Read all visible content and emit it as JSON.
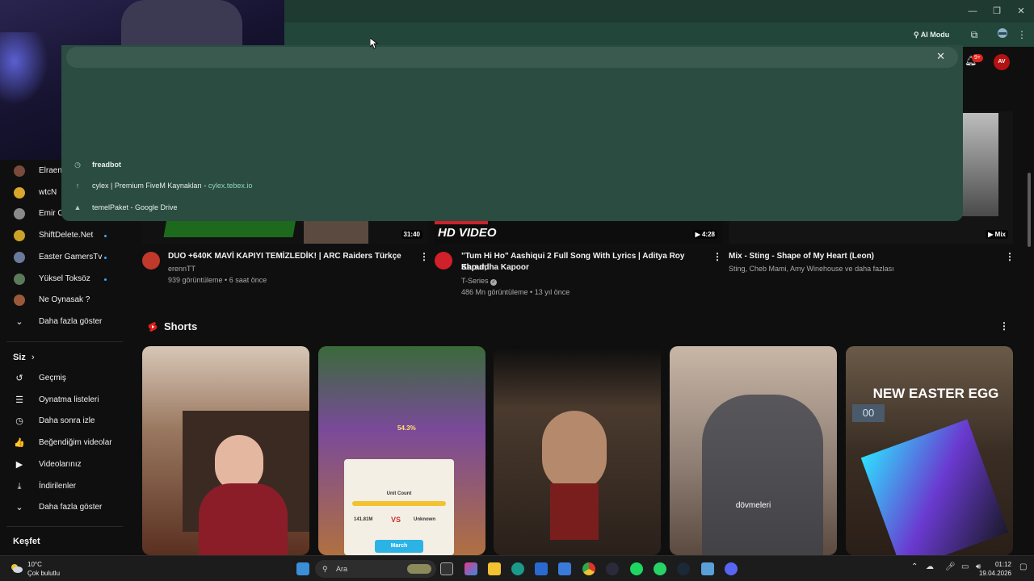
{
  "browser": {
    "ai_mode_label": "AI Modu",
    "omnibox_suggestions": [
      {
        "icon": "clock-icon",
        "text": "freadbot",
        "bold": true,
        "domain": ""
      },
      {
        "icon": "arrow-up-icon",
        "text": "cylex | Premium FiveM Kaynakları",
        "bold": false,
        "domain": "cylex.tebex.io"
      },
      {
        "icon": "google-drive-icon",
        "text": "temelPaket - Google Drive",
        "bold": false,
        "domain": ""
      }
    ],
    "notification_count": "9+",
    "avatar_text": "AV"
  },
  "sidebar": {
    "subscriptions": [
      {
        "label": "Elraenn",
        "live": false,
        "color": "#7a4a3a"
      },
      {
        "label": "wtcN",
        "live": false,
        "color": "#d8a72b"
      },
      {
        "label": "Emir C",
        "live": false,
        "color": "#8a8a8a"
      },
      {
        "label": "ShiftDelete.Net",
        "live": true,
        "color": "#c9a227"
      },
      {
        "label": "Easter GamersTv",
        "live": true,
        "color": "#6a7a9a"
      },
      {
        "label": "Yüksel Toksöz",
        "live": true,
        "color": "#5a7a5a"
      },
      {
        "label": "Ne Oynasak ?",
        "live": false,
        "color": "#9a5a3a"
      }
    ],
    "show_more_1": "Daha fazla göster",
    "you_header": "Siz",
    "you_items": [
      {
        "icon": "history-icon",
        "glyph": "↺",
        "label": "Geçmiş"
      },
      {
        "icon": "playlist-icon",
        "glyph": "☰",
        "label": "Oynatma listeleri"
      },
      {
        "icon": "clock-icon",
        "glyph": "◷",
        "label": "Daha sonra izle"
      },
      {
        "icon": "thumbs-up-icon",
        "glyph": "👍",
        "label": "Beğendiğim videolar"
      },
      {
        "icon": "video-icon",
        "glyph": "▶",
        "label": "Videolarınız"
      },
      {
        "icon": "download-icon",
        "glyph": "⤓",
        "label": "İndirilenler"
      }
    ],
    "show_more_2": "Daha fazla göster",
    "explore_header": "Keşfet"
  },
  "videos": [
    {
      "title": "DUO +640K MAVİ KAPIYI TEMİZLEDİK! | ARC Raiders Türkçe",
      "title2": "",
      "channel": "erennTT",
      "meta": "939 görüntüleme • 6 saat önce",
      "duration": "31:40",
      "avatar_color": "#c0392b"
    },
    {
      "title": "\"Tum Hi Ho\" Aashiqui 2 Full Song With Lyrics | Aditya Roy Kapur,",
      "title2": "Shraddha Kapoor",
      "channel": "T-Series",
      "meta": "486 Mn görüntüleme • 13 yıl önce",
      "duration": "4:28",
      "overlay": "HD VIDEO",
      "avatar_color": "#d0202a"
    },
    {
      "title": "Mix - Sting - Shape of My Heart (Leon)",
      "title2": "",
      "channel": "Sting, Cheb Mami, Amy Winehouse ve daha fazlası",
      "meta": "",
      "duration": "Mix",
      "avatar_color": ""
    }
  ],
  "shorts": {
    "header": "Shorts",
    "items": [
      {
        "caption": "",
        "bg": "#6b4a3a"
      },
      {
        "caption": "",
        "bg": "#4a3a6a"
      },
      {
        "caption": "",
        "bg": "#3a2e26"
      },
      {
        "caption": "dövmeleri",
        "bg": "#8a7a70"
      },
      {
        "caption": "NEW EASTER EGG",
        "bg": "#5a4a3a"
      }
    ],
    "short2_labels": {
      "percent": "54.3%",
      "unit_count": "Unit Count",
      "vs": "VS",
      "unknown": "Unknown",
      "march": "March",
      "power": "141.81M"
    },
    "short5_counter": "00"
  },
  "taskbar": {
    "weather_temp": "10°C",
    "weather_text": "Çok bulutlu",
    "search_placeholder": "Ara",
    "time": "01:12",
    "date": "19.04.2026"
  }
}
